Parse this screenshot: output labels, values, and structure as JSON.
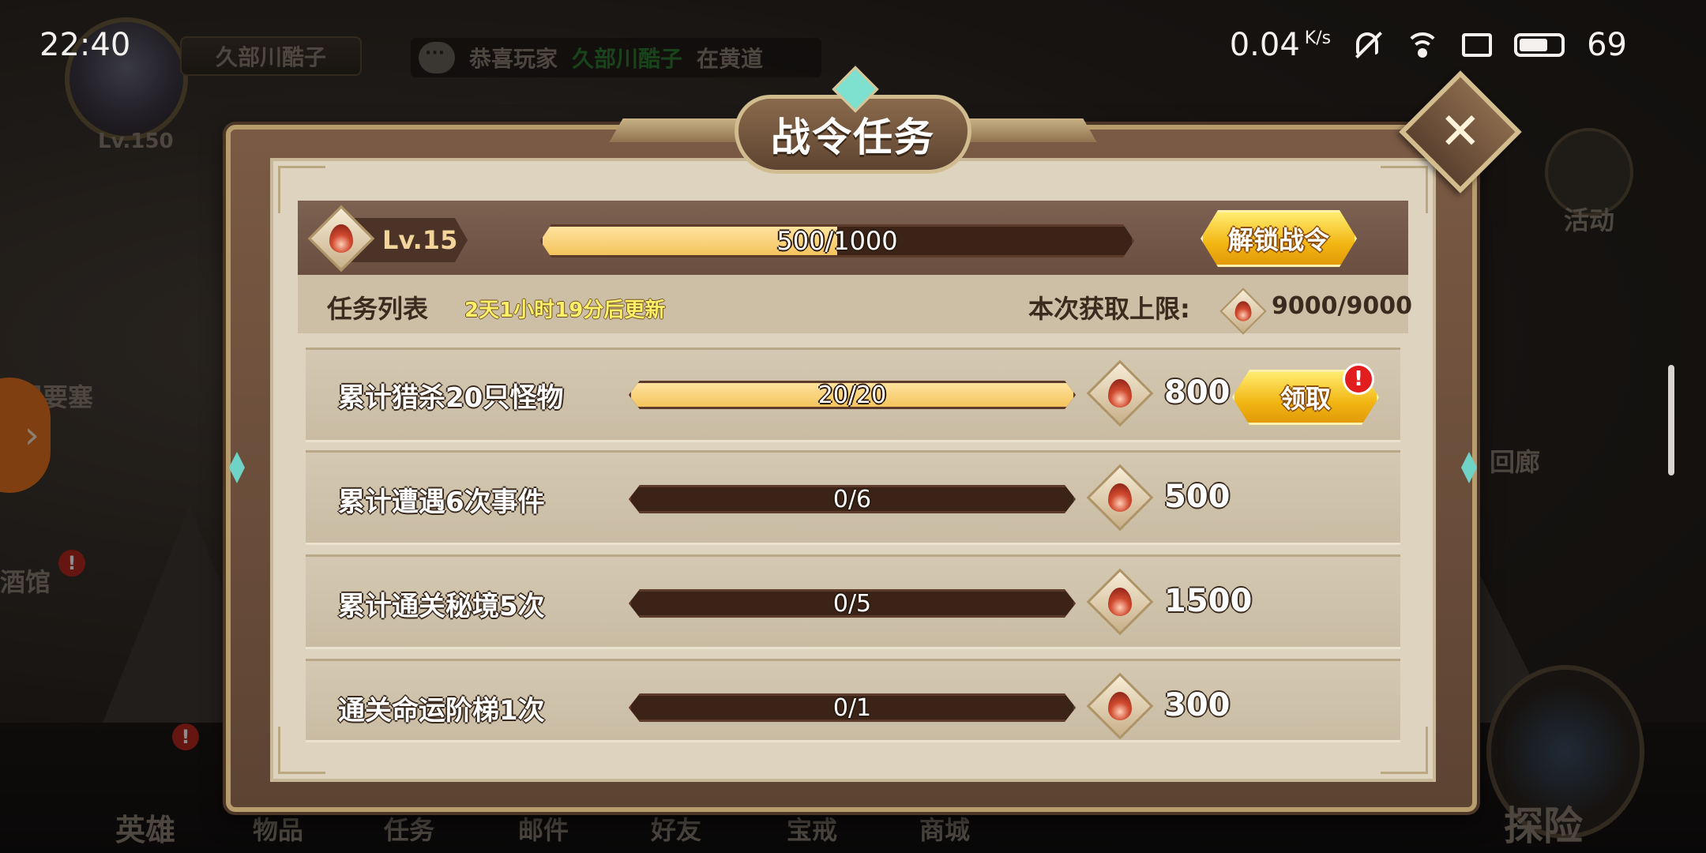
{
  "status_bar": {
    "time": "22:40",
    "net_speed": "0.04",
    "net_unit": "K/s",
    "battery": "69"
  },
  "background": {
    "player_name": "久部川酷子",
    "player_level": "Lv.150",
    "chat_prefix": "恭喜玩家",
    "chat_suffix": "在黄道",
    "left_labels": [
      "无限要塞",
      "酒馆"
    ],
    "right_labels": [
      "活动",
      "回廊"
    ],
    "bottom_nav": [
      "英雄",
      "物品",
      "任务",
      "邮件",
      "好友",
      "宝戒",
      "商城",
      "探险"
    ]
  },
  "panel": {
    "title": "战令任务",
    "close_symbol": "✕",
    "level": "Lv.15",
    "exp_text": "500/1000",
    "exp_progress": 0.5,
    "unlock_button": "解锁战令",
    "task_list_label": "任务列表",
    "refresh_text": "2天1小时19分后更新",
    "limit_label": "本次获取上限:",
    "limit_value": "9000/9000"
  },
  "tasks": [
    {
      "name": "累计猎杀20只怪物",
      "progress_text": "20/20",
      "progress": 1.0,
      "reward": "800",
      "claim_label": "领取",
      "claimable": true
    },
    {
      "name": "累计遭遇6次事件",
      "progress_text": "0/6",
      "progress": 0.0,
      "reward": "500"
    },
    {
      "name": "累计通关秘境5次",
      "progress_text": "0/5",
      "progress": 0.0,
      "reward": "1500"
    },
    {
      "name": "通关命运阶梯1次",
      "progress_text": "0/1",
      "progress": 0.0,
      "reward": "300"
    }
  ],
  "alert_symbol": "!",
  "colors": {
    "gold_button": "#f2b613",
    "progress_fill": "#f4c45d",
    "panel_frame": "#7a5a44"
  }
}
